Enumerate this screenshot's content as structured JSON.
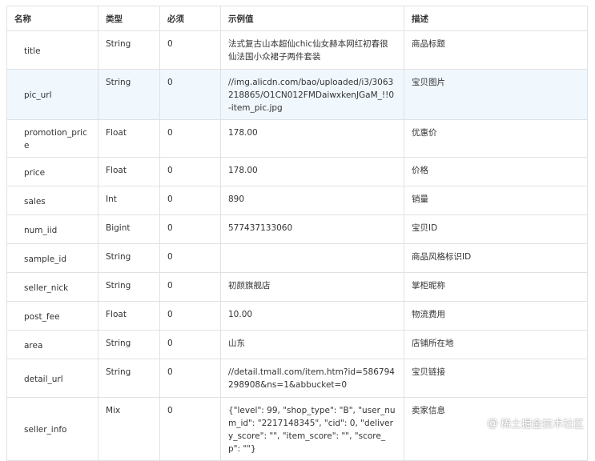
{
  "table": {
    "headers": [
      "名称",
      "类型",
      "必须",
      "示例值",
      "描述"
    ],
    "rows": [
      {
        "name": "title",
        "type": "String",
        "required": "0",
        "example": "法式复古山本超仙chic仙女赫本网红初春很仙法国小众裙子两件套装",
        "description": "商品标题"
      },
      {
        "name": "pic_url",
        "type": "String",
        "required": "0",
        "example": "//img.alicdn.com/bao/uploaded/i3/3063218865/O1CN012FMDaiwxkenJGaM_!!0-item_pic.jpg",
        "description": "宝贝图片"
      },
      {
        "name": "promotion_price",
        "type": "Float",
        "required": "0",
        "example": "178.00",
        "description": "优惠价"
      },
      {
        "name": "price",
        "type": "Float",
        "required": "0",
        "example": "178.00",
        "description": "价格"
      },
      {
        "name": "sales",
        "type": "Int",
        "required": "0",
        "example": "890",
        "description": "销量"
      },
      {
        "name": "num_iid",
        "type": "Bigint",
        "required": "0",
        "example": "577437133060",
        "description": "宝贝ID"
      },
      {
        "name": "sample_id",
        "type": "String",
        "required": "0",
        "example": "",
        "description": "商品风格标识ID"
      },
      {
        "name": "seller_nick",
        "type": "String",
        "required": "0",
        "example": "初颜旗舰店",
        "description": "掌柜昵称"
      },
      {
        "name": "post_fee",
        "type": "Float",
        "required": "0",
        "example": "10.00",
        "description": "物流费用"
      },
      {
        "name": "area",
        "type": "String",
        "required": "0",
        "example": "山东",
        "description": "店铺所在地"
      },
      {
        "name": "detail_url",
        "type": "String",
        "required": "0",
        "example": "//detail.tmall.com/item.htm?id=586794298908&ns=1&abbucket=0",
        "description": "宝贝链接"
      },
      {
        "name": "seller_info",
        "type": "Mix",
        "required": "0",
        "example": "{\"level\": 99, \"shop_type\": \"B\", \"user_num_id\": \"2217148345\", \"cid\": 0, \"delivery_score\": \"\", \"item_score\": \"\", \"score_p\": \"\"}",
        "description": "卖家信息"
      }
    ]
  },
  "watermark": {
    "icon": "at-sign-icon",
    "text": "稀土掘金技术社区"
  }
}
